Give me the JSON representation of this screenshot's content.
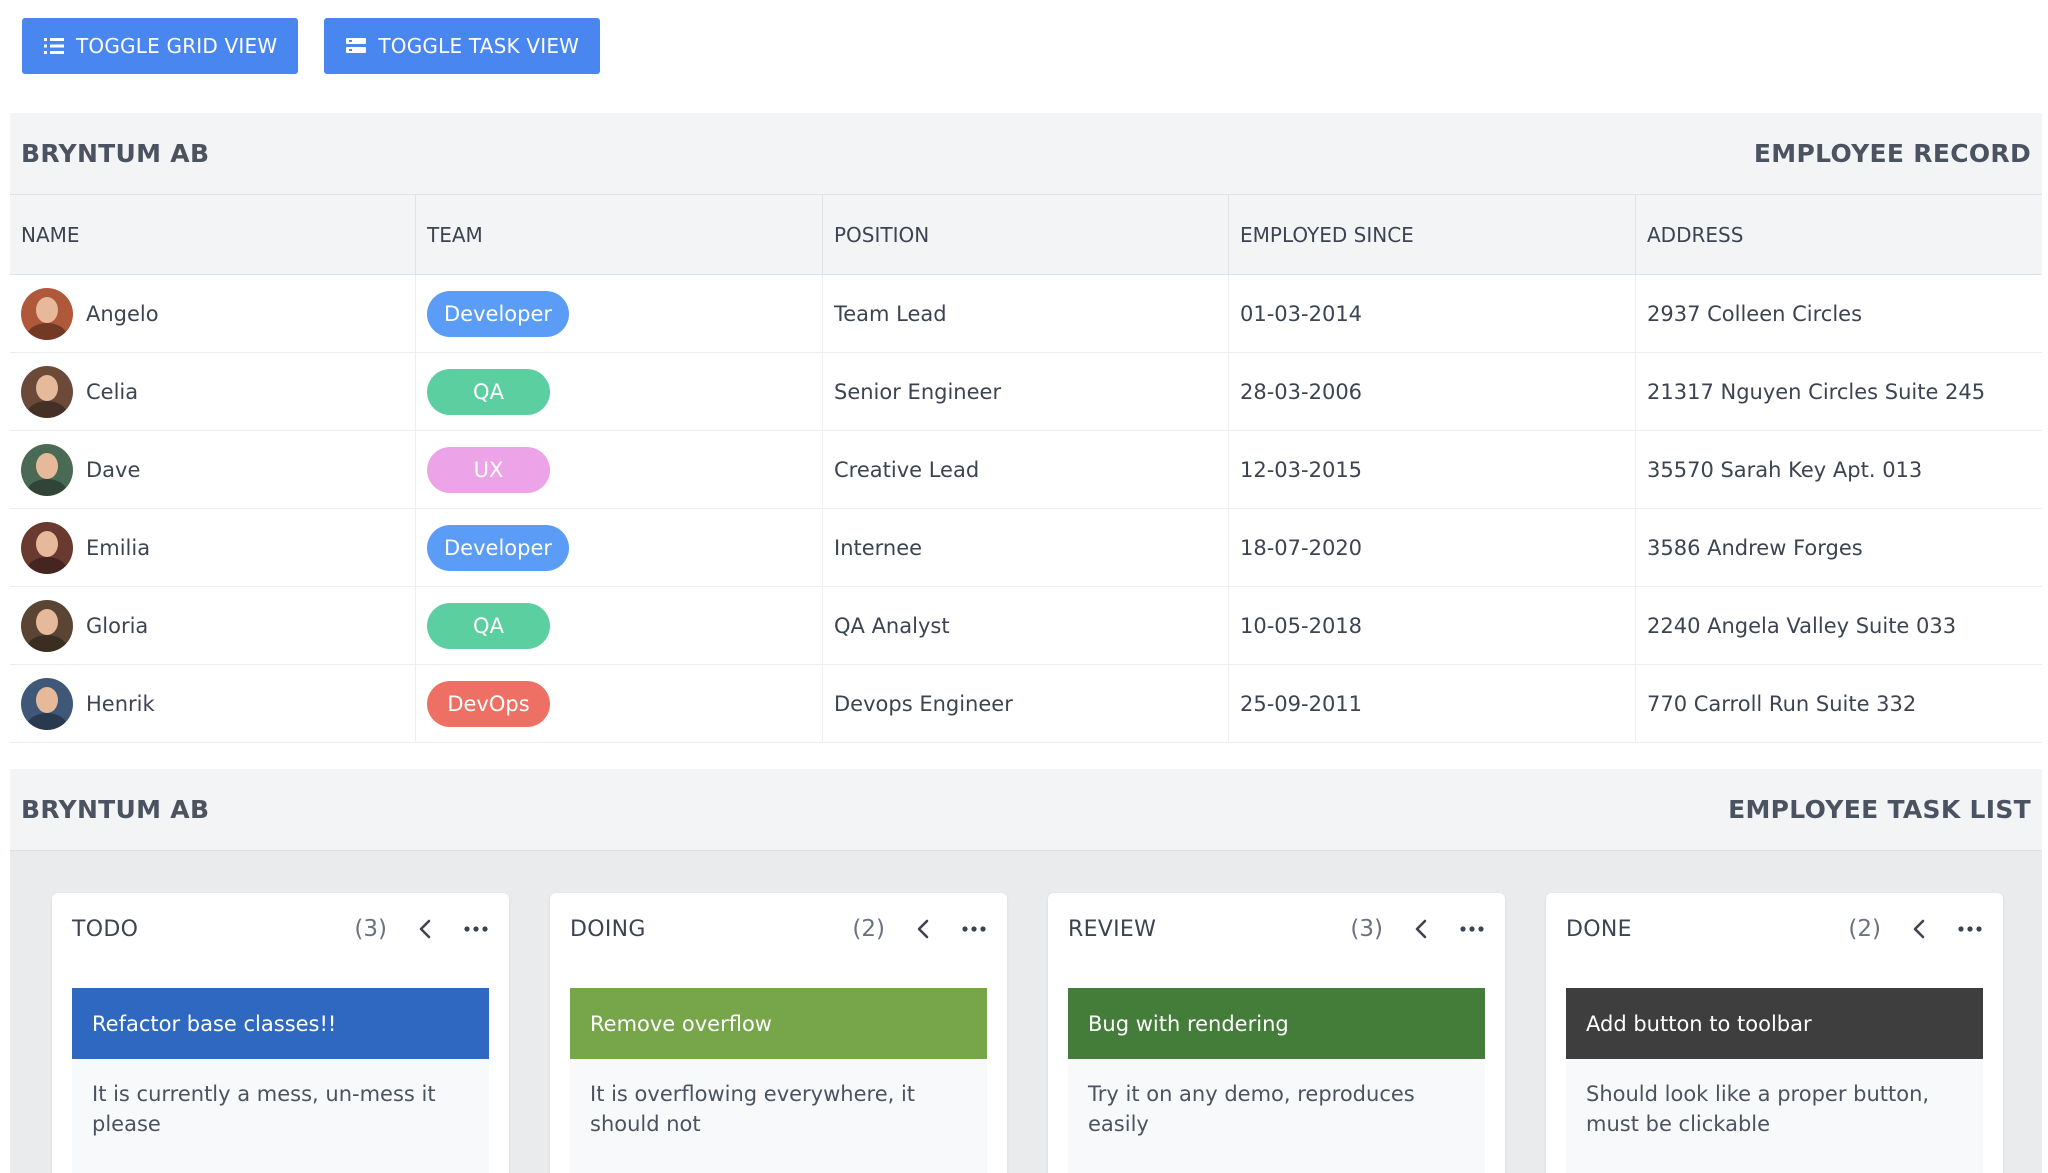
{
  "toolbar": {
    "grid_label": "TOGGLE GRID VIEW",
    "grid_icon": "list-icon",
    "task_label": "TOGGLE TASK VIEW",
    "task_icon": "layers-icon",
    "button_color": "#4a86f0"
  },
  "grid": {
    "company": "BRYNTUM AB",
    "title": "EMPLOYEE RECORD",
    "columns": [
      "NAME",
      "TEAM",
      "POSITION",
      "EMPLOYED SINCE",
      "ADDRESS"
    ],
    "rows": [
      {
        "name": "Angelo",
        "team": "Developer",
        "team_color": "#5b9cf6",
        "position": "Team Lead",
        "since": "01-03-2014",
        "address": "2937 Colleen Circles"
      },
      {
        "name": "Celia",
        "team": "QA",
        "team_color": "#5ccfa0",
        "position": "Senior Engineer",
        "since": "28-03-2006",
        "address": "21317 Nguyen Circles Suite 245"
      },
      {
        "name": "Dave",
        "team": "UX",
        "team_color": "#eda3e8",
        "position": "Creative Lead",
        "since": "12-03-2015",
        "address": "35570 Sarah Key Apt. 013"
      },
      {
        "name": "Emilia",
        "team": "Developer",
        "team_color": "#5b9cf6",
        "position": "Internee",
        "since": "18-07-2020",
        "address": "3586 Andrew Forges"
      },
      {
        "name": "Gloria",
        "team": "QA",
        "team_color": "#5ccfa0",
        "position": "QA Analyst",
        "since": "10-05-2018",
        "address": "2240 Angela Valley Suite 033"
      },
      {
        "name": "Henrik",
        "team": "DevOps",
        "team_color": "#ee7064",
        "position": "Devops Engineer",
        "since": "25-09-2011",
        "address": "770 Carroll Run Suite 332"
      }
    ]
  },
  "board": {
    "company": "BRYNTUM AB",
    "title": "EMPLOYEE TASK LIST",
    "columns": [
      {
        "name": "TODO",
        "count": "(3)",
        "card": {
          "title": "Refactor base classes!!",
          "body": "It is currently a mess, un-mess it please",
          "color": "#2f68c0"
        }
      },
      {
        "name": "DOING",
        "count": "(2)",
        "card": {
          "title": "Remove overflow",
          "body": "It is overflowing everywhere, it should not",
          "color": "#77a549"
        }
      },
      {
        "name": "REVIEW",
        "count": "(3)",
        "card": {
          "title": "Bug with rendering",
          "body": "Try it on any demo, reproduces easily",
          "color": "#447c3a"
        }
      },
      {
        "name": "DONE",
        "count": "(2)",
        "card": {
          "title": "Add button to toolbar",
          "body": "Should look like a proper button, must be clickable",
          "color": "#3e3e3e"
        }
      }
    ]
  },
  "avatar_colors": [
    "#b0593a",
    "#6b4a3a",
    "#4b6a55",
    "#6a3a30",
    "#5a4535",
    "#3f5878"
  ]
}
